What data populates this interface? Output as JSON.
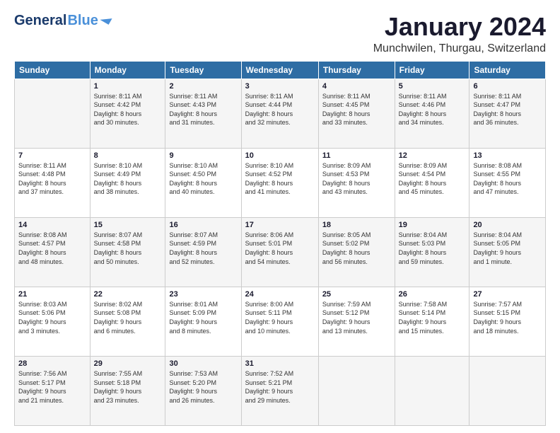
{
  "logo": {
    "text1": "General",
    "text2": "Blue"
  },
  "header": {
    "title": "January 2024",
    "subtitle": "Munchwilen, Thurgau, Switzerland"
  },
  "weekdays": [
    "Sunday",
    "Monday",
    "Tuesday",
    "Wednesday",
    "Thursday",
    "Friday",
    "Saturday"
  ],
  "weeks": [
    [
      {
        "day": "",
        "info": ""
      },
      {
        "day": "1",
        "info": "Sunrise: 8:11 AM\nSunset: 4:42 PM\nDaylight: 8 hours\nand 30 minutes."
      },
      {
        "day": "2",
        "info": "Sunrise: 8:11 AM\nSunset: 4:43 PM\nDaylight: 8 hours\nand 31 minutes."
      },
      {
        "day": "3",
        "info": "Sunrise: 8:11 AM\nSunset: 4:44 PM\nDaylight: 8 hours\nand 32 minutes."
      },
      {
        "day": "4",
        "info": "Sunrise: 8:11 AM\nSunset: 4:45 PM\nDaylight: 8 hours\nand 33 minutes."
      },
      {
        "day": "5",
        "info": "Sunrise: 8:11 AM\nSunset: 4:46 PM\nDaylight: 8 hours\nand 34 minutes."
      },
      {
        "day": "6",
        "info": "Sunrise: 8:11 AM\nSunset: 4:47 PM\nDaylight: 8 hours\nand 36 minutes."
      }
    ],
    [
      {
        "day": "7",
        "info": "Sunrise: 8:11 AM\nSunset: 4:48 PM\nDaylight: 8 hours\nand 37 minutes."
      },
      {
        "day": "8",
        "info": "Sunrise: 8:10 AM\nSunset: 4:49 PM\nDaylight: 8 hours\nand 38 minutes."
      },
      {
        "day": "9",
        "info": "Sunrise: 8:10 AM\nSunset: 4:50 PM\nDaylight: 8 hours\nand 40 minutes."
      },
      {
        "day": "10",
        "info": "Sunrise: 8:10 AM\nSunset: 4:52 PM\nDaylight: 8 hours\nand 41 minutes."
      },
      {
        "day": "11",
        "info": "Sunrise: 8:09 AM\nSunset: 4:53 PM\nDaylight: 8 hours\nand 43 minutes."
      },
      {
        "day": "12",
        "info": "Sunrise: 8:09 AM\nSunset: 4:54 PM\nDaylight: 8 hours\nand 45 minutes."
      },
      {
        "day": "13",
        "info": "Sunrise: 8:08 AM\nSunset: 4:55 PM\nDaylight: 8 hours\nand 47 minutes."
      }
    ],
    [
      {
        "day": "14",
        "info": "Sunrise: 8:08 AM\nSunset: 4:57 PM\nDaylight: 8 hours\nand 48 minutes."
      },
      {
        "day": "15",
        "info": "Sunrise: 8:07 AM\nSunset: 4:58 PM\nDaylight: 8 hours\nand 50 minutes."
      },
      {
        "day": "16",
        "info": "Sunrise: 8:07 AM\nSunset: 4:59 PM\nDaylight: 8 hours\nand 52 minutes."
      },
      {
        "day": "17",
        "info": "Sunrise: 8:06 AM\nSunset: 5:01 PM\nDaylight: 8 hours\nand 54 minutes."
      },
      {
        "day": "18",
        "info": "Sunrise: 8:05 AM\nSunset: 5:02 PM\nDaylight: 8 hours\nand 56 minutes."
      },
      {
        "day": "19",
        "info": "Sunrise: 8:04 AM\nSunset: 5:03 PM\nDaylight: 8 hours\nand 59 minutes."
      },
      {
        "day": "20",
        "info": "Sunrise: 8:04 AM\nSunset: 5:05 PM\nDaylight: 9 hours\nand 1 minute."
      }
    ],
    [
      {
        "day": "21",
        "info": "Sunrise: 8:03 AM\nSunset: 5:06 PM\nDaylight: 9 hours\nand 3 minutes."
      },
      {
        "day": "22",
        "info": "Sunrise: 8:02 AM\nSunset: 5:08 PM\nDaylight: 9 hours\nand 6 minutes."
      },
      {
        "day": "23",
        "info": "Sunrise: 8:01 AM\nSunset: 5:09 PM\nDaylight: 9 hours\nand 8 minutes."
      },
      {
        "day": "24",
        "info": "Sunrise: 8:00 AM\nSunset: 5:11 PM\nDaylight: 9 hours\nand 10 minutes."
      },
      {
        "day": "25",
        "info": "Sunrise: 7:59 AM\nSunset: 5:12 PM\nDaylight: 9 hours\nand 13 minutes."
      },
      {
        "day": "26",
        "info": "Sunrise: 7:58 AM\nSunset: 5:14 PM\nDaylight: 9 hours\nand 15 minutes."
      },
      {
        "day": "27",
        "info": "Sunrise: 7:57 AM\nSunset: 5:15 PM\nDaylight: 9 hours\nand 18 minutes."
      }
    ],
    [
      {
        "day": "28",
        "info": "Sunrise: 7:56 AM\nSunset: 5:17 PM\nDaylight: 9 hours\nand 21 minutes."
      },
      {
        "day": "29",
        "info": "Sunrise: 7:55 AM\nSunset: 5:18 PM\nDaylight: 9 hours\nand 23 minutes."
      },
      {
        "day": "30",
        "info": "Sunrise: 7:53 AM\nSunset: 5:20 PM\nDaylight: 9 hours\nand 26 minutes."
      },
      {
        "day": "31",
        "info": "Sunrise: 7:52 AM\nSunset: 5:21 PM\nDaylight: 9 hours\nand 29 minutes."
      },
      {
        "day": "",
        "info": ""
      },
      {
        "day": "",
        "info": ""
      },
      {
        "day": "",
        "info": ""
      }
    ]
  ]
}
